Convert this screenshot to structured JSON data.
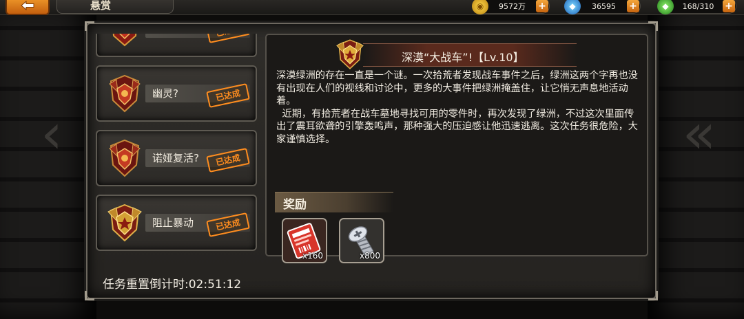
{
  "top_bar": {
    "back_label": "",
    "screen_title": "悬赏",
    "resources": {
      "gold": {
        "value": "9572万",
        "icon": "gold-coin-icon"
      },
      "gems": {
        "value": "36595",
        "icon": "gem-icon"
      },
      "energy": {
        "value": "168/310",
        "icon": "energy-crystal-icon"
      }
    },
    "plus_label": "+"
  },
  "quest_list": {
    "items": [
      {
        "label": "…",
        "status": "已达成"
      },
      {
        "label": "幽灵?",
        "status": "已达成"
      },
      {
        "label": "诺娅复活?",
        "status": "已达成"
      },
      {
        "label": "阻止暴动",
        "status": "已达成"
      }
    ]
  },
  "detail": {
    "title": "深漠“大战车”!【Lv.10】",
    "paragraph1": "深漠绿洲的存在一直是一个谜。一次拾荒者发现战车事件之后，绿洲这两个字再也没有出现在人们的视线和讨论中，更多的大事件把绿洲掩盖住，让它悄无声息地活动着。",
    "paragraph2": "近期，有拾荒者在战车墓地寻找可用的零件时，再次发现了绿洲，不过这次里面传出了震耳欲聋的引擎轰鸣声，那种强大的压迫感让他迅速逃离。这次任务很危险，大家谨慎选择。",
    "reward_title": "奖励",
    "rewards": [
      {
        "icon": "ticket-icon",
        "count": "x160"
      },
      {
        "icon": "bolt-screw-icon",
        "count": "x800"
      }
    ]
  },
  "timer": {
    "text": "任务重置倒计时:02:51:12"
  },
  "colors": {
    "accent_orange": "#ff8d1f",
    "panel_bg": "#2f2d2a"
  }
}
